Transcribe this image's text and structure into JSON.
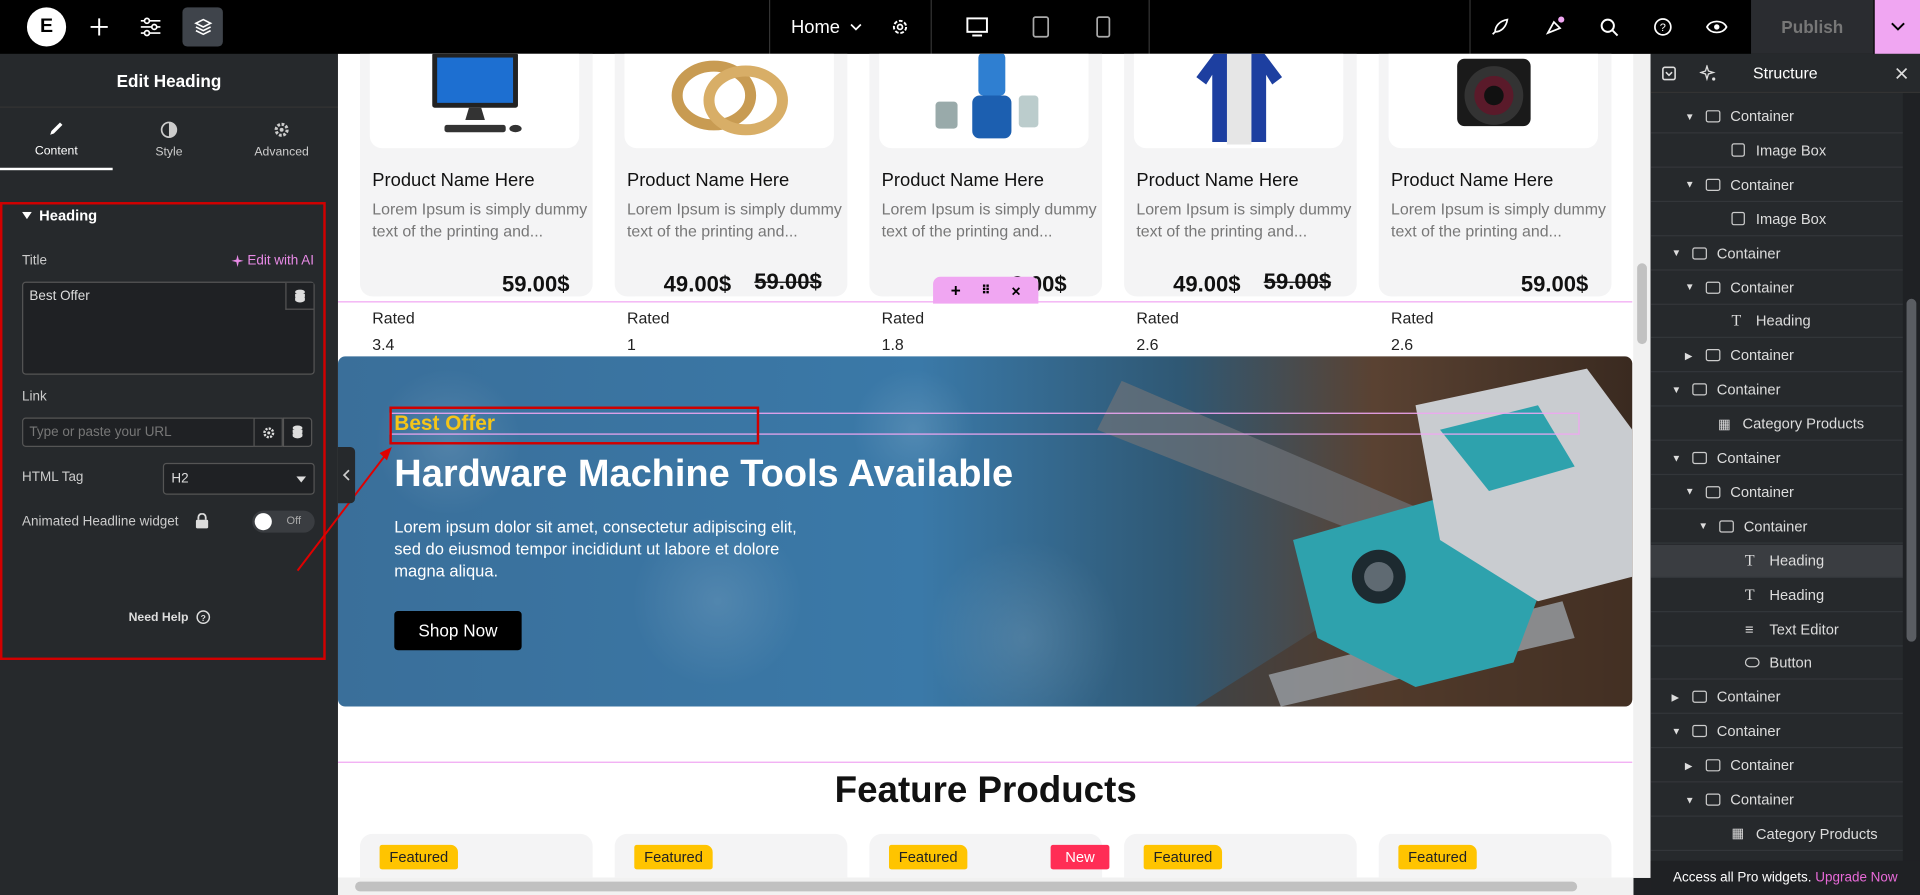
{
  "topbar": {
    "page_name": "Home",
    "publish_label": "Publish"
  },
  "left_panel": {
    "title": "Edit Heading",
    "tabs": [
      {
        "label": "Content"
      },
      {
        "label": "Style"
      },
      {
        "label": "Advanced"
      }
    ],
    "section_title": "Heading",
    "title_label": "Title",
    "edit_ai_label": "Edit with AI",
    "title_value": "Best Offer",
    "link_label": "Link",
    "link_placeholder": "Type or paste your URL",
    "html_tag_label": "HTML Tag",
    "html_tag_value": "H2",
    "animated_label": "Animated Headline widget",
    "toggle_label": "Off",
    "need_help_label": "Need Help"
  },
  "canvas": {
    "products": [
      {
        "name": "Product Name Here",
        "desc": "Lorem Ipsum is simply dummy text of the printing and...",
        "price": "59.00$",
        "old_price": "",
        "rated_label": "Rated",
        "rating": "3.4"
      },
      {
        "name": "Product Name Here",
        "desc": "Lorem Ipsum is simply dummy text of the printing and...",
        "price": "49.00$",
        "old_price": "59.00$",
        "rated_label": "Rated",
        "rating": "1"
      },
      {
        "name": "Product Name Here",
        "desc": "Lorem Ipsum is simply dummy text of the printing and...",
        "price": "9.00$",
        "old_price": "",
        "rated_label": "Rated",
        "rating": "1.8"
      },
      {
        "name": "Product Name Here",
        "desc": "Lorem Ipsum is simply dummy text of the printing and...",
        "price": "49.00$",
        "old_price": "59.00$",
        "rated_label": "Rated",
        "rating": "2.6"
      },
      {
        "name": "Product Name Here",
        "desc": "Lorem Ipsum is simply dummy text of the printing and...",
        "price": "59.00$",
        "old_price": "",
        "rated_label": "Rated",
        "rating": "2.6"
      }
    ],
    "banner": {
      "kicker": "Best Offer",
      "heading": "Hardware Machine Tools Available",
      "body": "Lorem ipsum dolor sit amet, consectetur adipiscing elit, sed do eiusmod tempor incididunt ut labore et dolore magna aliqua.",
      "button": "Shop Now"
    },
    "feature_title": "Feature Products",
    "featured_badge": "Featured",
    "new_badge": "New"
  },
  "structure": {
    "title": "Structure",
    "footer_text": "Access all Pro widgets.",
    "footer_link": "Upgrade Now",
    "items": [
      {
        "label": "Container"
      },
      {
        "label": "Image Box"
      },
      {
        "label": "Container"
      },
      {
        "label": "Image Box"
      },
      {
        "label": "Container"
      },
      {
        "label": "Container"
      },
      {
        "label": "Heading"
      },
      {
        "label": "Container"
      },
      {
        "label": "Container"
      },
      {
        "label": "Category Products"
      },
      {
        "label": "Container"
      },
      {
        "label": "Container"
      },
      {
        "label": "Container"
      },
      {
        "label": "Heading"
      },
      {
        "label": "Heading"
      },
      {
        "label": "Text Editor"
      },
      {
        "label": "Button"
      },
      {
        "label": "Container"
      },
      {
        "label": "Container"
      },
      {
        "label": "Container"
      },
      {
        "label": "Container"
      },
      {
        "label": "Category Products"
      }
    ]
  },
  "colors": {
    "accent_pink": "#f0a6f2",
    "selection_red": "#d10000",
    "badge_yellow": "#ffc400",
    "badge_red": "#ff2d55",
    "banner_kicker": "#f5c518",
    "upgrade_pink": "#e86ad8"
  }
}
